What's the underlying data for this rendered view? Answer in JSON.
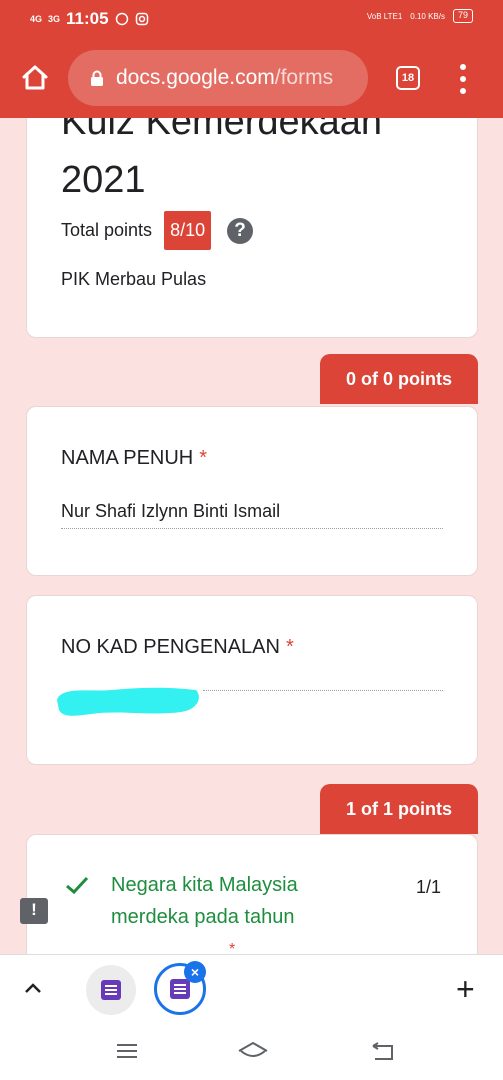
{
  "status_bar": {
    "signal_1": "4G",
    "signal_2": "3G",
    "time": "11:05",
    "volte": "VoB LTE1",
    "speed": "0.10 KB/s",
    "battery": "79"
  },
  "browser": {
    "url_host": "docs.google.com",
    "url_path": "/forms",
    "tab_count": "18"
  },
  "form": {
    "title": "Kuiz Kemerdekaan 2021",
    "total_points_label": "Total points",
    "total_points_value": "8/10",
    "organization": "PIK Merbau Pulas"
  },
  "sections": [
    {
      "points": "0 of 0 points"
    },
    {
      "points": "1 of 1 points"
    }
  ],
  "questions": [
    {
      "label": "NAMA PENUH",
      "required": "*",
      "answer": "Nur Shafi Izlynn Binti Ismail"
    },
    {
      "label": "NO KAD PENGENALAN",
      "required": "*",
      "answer": ""
    },
    {
      "label": "Negara kita Malaysia merdeka pada tahun",
      "required": "*",
      "score": "1/1"
    }
  ],
  "colors": {
    "accent": "#db4437",
    "correct": "#1e8e3e",
    "redaction": "#33f1f1"
  },
  "icons": {
    "home": "home-icon",
    "lock": "lock-icon",
    "menu": "more-vert-icon",
    "help": "help-icon",
    "check": "check-icon",
    "feedback": "feedback-icon"
  }
}
